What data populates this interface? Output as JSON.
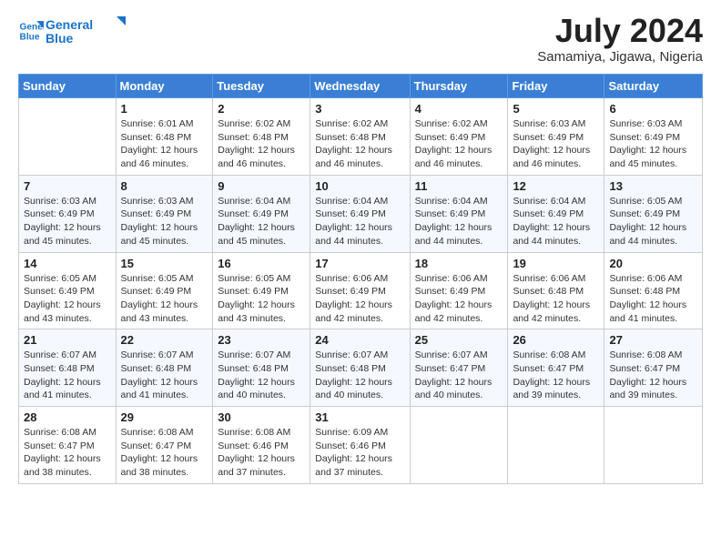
{
  "header": {
    "logo_line1": "General",
    "logo_line2": "Blue",
    "month_year": "July 2024",
    "location": "Samamiya, Jigawa, Nigeria"
  },
  "weekdays": [
    "Sunday",
    "Monday",
    "Tuesday",
    "Wednesday",
    "Thursday",
    "Friday",
    "Saturday"
  ],
  "weeks": [
    [
      {
        "day": "",
        "info": ""
      },
      {
        "day": "1",
        "info": "Sunrise: 6:01 AM\nSunset: 6:48 PM\nDaylight: 12 hours\nand 46 minutes."
      },
      {
        "day": "2",
        "info": "Sunrise: 6:02 AM\nSunset: 6:48 PM\nDaylight: 12 hours\nand 46 minutes."
      },
      {
        "day": "3",
        "info": "Sunrise: 6:02 AM\nSunset: 6:48 PM\nDaylight: 12 hours\nand 46 minutes."
      },
      {
        "day": "4",
        "info": "Sunrise: 6:02 AM\nSunset: 6:49 PM\nDaylight: 12 hours\nand 46 minutes."
      },
      {
        "day": "5",
        "info": "Sunrise: 6:03 AM\nSunset: 6:49 PM\nDaylight: 12 hours\nand 46 minutes."
      },
      {
        "day": "6",
        "info": "Sunrise: 6:03 AM\nSunset: 6:49 PM\nDaylight: 12 hours\nand 45 minutes."
      }
    ],
    [
      {
        "day": "7",
        "info": "Sunrise: 6:03 AM\nSunset: 6:49 PM\nDaylight: 12 hours\nand 45 minutes."
      },
      {
        "day": "8",
        "info": "Sunrise: 6:03 AM\nSunset: 6:49 PM\nDaylight: 12 hours\nand 45 minutes."
      },
      {
        "day": "9",
        "info": "Sunrise: 6:04 AM\nSunset: 6:49 PM\nDaylight: 12 hours\nand 45 minutes."
      },
      {
        "day": "10",
        "info": "Sunrise: 6:04 AM\nSunset: 6:49 PM\nDaylight: 12 hours\nand 44 minutes."
      },
      {
        "day": "11",
        "info": "Sunrise: 6:04 AM\nSunset: 6:49 PM\nDaylight: 12 hours\nand 44 minutes."
      },
      {
        "day": "12",
        "info": "Sunrise: 6:04 AM\nSunset: 6:49 PM\nDaylight: 12 hours\nand 44 minutes."
      },
      {
        "day": "13",
        "info": "Sunrise: 6:05 AM\nSunset: 6:49 PM\nDaylight: 12 hours\nand 44 minutes."
      }
    ],
    [
      {
        "day": "14",
        "info": "Sunrise: 6:05 AM\nSunset: 6:49 PM\nDaylight: 12 hours\nand 43 minutes."
      },
      {
        "day": "15",
        "info": "Sunrise: 6:05 AM\nSunset: 6:49 PM\nDaylight: 12 hours\nand 43 minutes."
      },
      {
        "day": "16",
        "info": "Sunrise: 6:05 AM\nSunset: 6:49 PM\nDaylight: 12 hours\nand 43 minutes."
      },
      {
        "day": "17",
        "info": "Sunrise: 6:06 AM\nSunset: 6:49 PM\nDaylight: 12 hours\nand 42 minutes."
      },
      {
        "day": "18",
        "info": "Sunrise: 6:06 AM\nSunset: 6:49 PM\nDaylight: 12 hours\nand 42 minutes."
      },
      {
        "day": "19",
        "info": "Sunrise: 6:06 AM\nSunset: 6:48 PM\nDaylight: 12 hours\nand 42 minutes."
      },
      {
        "day": "20",
        "info": "Sunrise: 6:06 AM\nSunset: 6:48 PM\nDaylight: 12 hours\nand 41 minutes."
      }
    ],
    [
      {
        "day": "21",
        "info": "Sunrise: 6:07 AM\nSunset: 6:48 PM\nDaylight: 12 hours\nand 41 minutes."
      },
      {
        "day": "22",
        "info": "Sunrise: 6:07 AM\nSunset: 6:48 PM\nDaylight: 12 hours\nand 41 minutes."
      },
      {
        "day": "23",
        "info": "Sunrise: 6:07 AM\nSunset: 6:48 PM\nDaylight: 12 hours\nand 40 minutes."
      },
      {
        "day": "24",
        "info": "Sunrise: 6:07 AM\nSunset: 6:48 PM\nDaylight: 12 hours\nand 40 minutes."
      },
      {
        "day": "25",
        "info": "Sunrise: 6:07 AM\nSunset: 6:47 PM\nDaylight: 12 hours\nand 40 minutes."
      },
      {
        "day": "26",
        "info": "Sunrise: 6:08 AM\nSunset: 6:47 PM\nDaylight: 12 hours\nand 39 minutes."
      },
      {
        "day": "27",
        "info": "Sunrise: 6:08 AM\nSunset: 6:47 PM\nDaylight: 12 hours\nand 39 minutes."
      }
    ],
    [
      {
        "day": "28",
        "info": "Sunrise: 6:08 AM\nSunset: 6:47 PM\nDaylight: 12 hours\nand 38 minutes."
      },
      {
        "day": "29",
        "info": "Sunrise: 6:08 AM\nSunset: 6:47 PM\nDaylight: 12 hours\nand 38 minutes."
      },
      {
        "day": "30",
        "info": "Sunrise: 6:08 AM\nSunset: 6:46 PM\nDaylight: 12 hours\nand 37 minutes."
      },
      {
        "day": "31",
        "info": "Sunrise: 6:09 AM\nSunset: 6:46 PM\nDaylight: 12 hours\nand 37 minutes."
      },
      {
        "day": "",
        "info": ""
      },
      {
        "day": "",
        "info": ""
      },
      {
        "day": "",
        "info": ""
      }
    ]
  ]
}
